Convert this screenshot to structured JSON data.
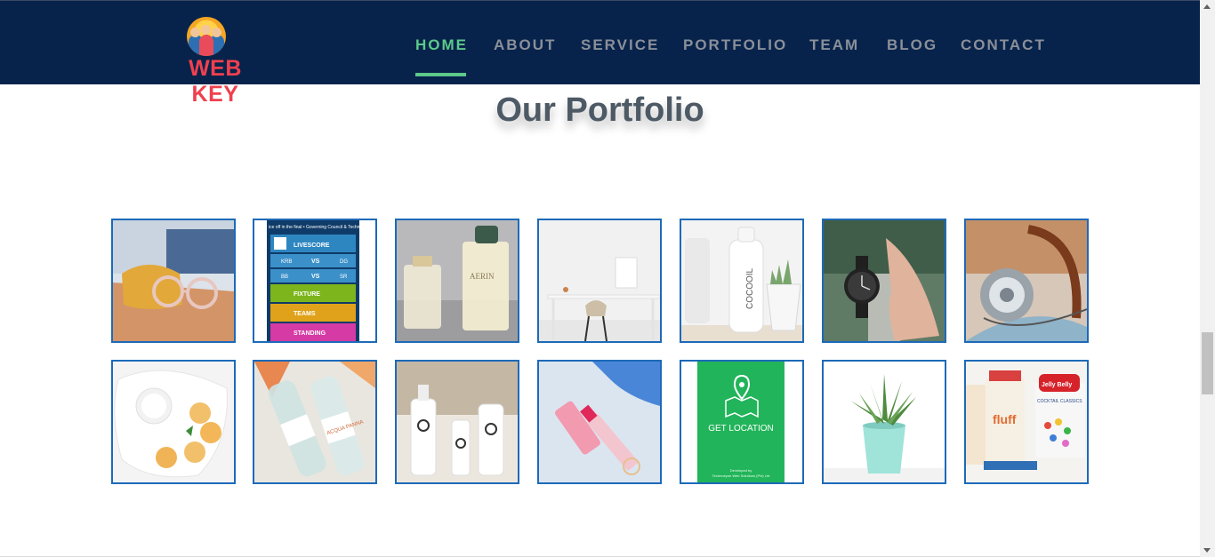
{
  "brand": {
    "name": "WEB KEY",
    "logo_icon": "team-people-icon"
  },
  "nav": {
    "items": [
      {
        "label": "HOME",
        "active": true
      },
      {
        "label": "ABOUT",
        "active": false
      },
      {
        "label": "SERVICE",
        "active": false
      },
      {
        "label": "PORTFOLIO",
        "active": false
      },
      {
        "label": "TEAM",
        "active": false
      },
      {
        "label": "BLOG",
        "active": false
      },
      {
        "label": "CONTACT",
        "active": false
      }
    ]
  },
  "portfolio": {
    "title": "Our Portfolio",
    "app_texts": {
      "banner": "ice off in the final • Governing Council & Technica",
      "livescore": "LIVESCORE",
      "match1": [
        "KRB",
        "VS",
        "DG"
      ],
      "match2": [
        "BB",
        "VS",
        "SR"
      ],
      "fixture": "FIXTURE",
      "teams": "TEAMS",
      "standing": "STANDING"
    },
    "location_texts": {
      "label": "GET LOCATION",
      "footer_line1": "Developed by",
      "footer_line2": "Technoeyon Web Solutions (Pvt) Ltd"
    },
    "product_texts": {
      "perfume": "AERIN",
      "cocooil": "COCOOIL",
      "aqua": "ACQUA PANNA",
      "fluff": "fluff",
      "jelly": "Jelly Belly",
      "cocktail": "COCKTAIL CLASSICS"
    }
  },
  "colors": {
    "header_bg": "#08234b",
    "accent_green": "#5cc98a",
    "brand_red": "#f0404e",
    "tile_border": "#1d6ab8"
  }
}
